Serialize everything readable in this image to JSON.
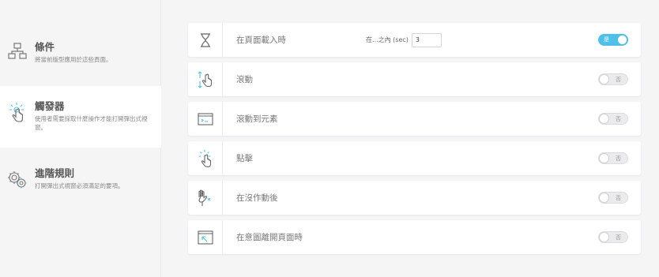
{
  "sidebar": {
    "items": [
      {
        "title": "條件",
        "desc": "將當前版型應用於這些頁面。",
        "icon": "sitemap-icon"
      },
      {
        "title": "觸發器",
        "desc": "使用者需要採取什麼操作才能打開彈出式視窗。",
        "icon": "click-hand-icon"
      },
      {
        "title": "進階規則",
        "desc": "打開彈出式視窗必須滿足的要項。",
        "icon": "gears-icon"
      }
    ]
  },
  "triggers": [
    {
      "label": "在頁面載入時",
      "extra_label": "在...之內 (sec)",
      "extra_value": "3",
      "toggle": "是",
      "on": true,
      "icon": "hourglass-icon"
    },
    {
      "label": "滾動",
      "toggle": "否",
      "on": false,
      "icon": "scroll-hand-icon"
    },
    {
      "label": "滾動到元素",
      "toggle": "否",
      "on": false,
      "icon": "scroll-to-element-icon"
    },
    {
      "label": "點擊",
      "toggle": "否",
      "on": false,
      "icon": "click-icon"
    },
    {
      "label": "在沒作動後",
      "toggle": "否",
      "on": false,
      "icon": "inactivity-hand-icon"
    },
    {
      "label": "在意圖離開頁面時",
      "toggle": "否",
      "on": false,
      "icon": "exit-intent-icon"
    }
  ],
  "colors": {
    "accent": "#4fc0ea",
    "active_icon": "#4fc0ea"
  }
}
